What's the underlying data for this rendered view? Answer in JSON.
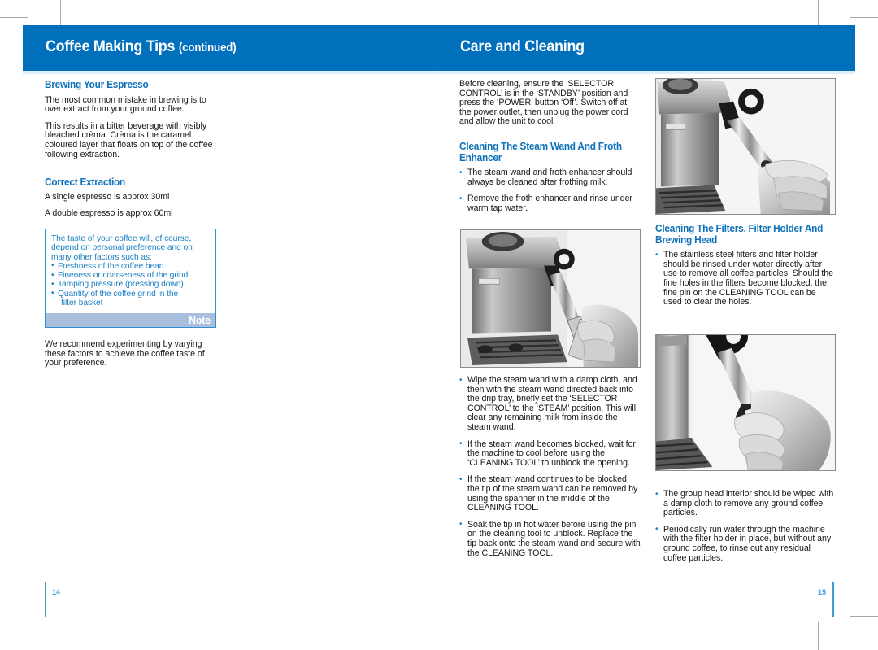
{
  "spread": {
    "left_page": {
      "header": {
        "title": "Coffee Making Tips",
        "suffix": "(continued)"
      },
      "folio": "14",
      "sections": [
        {
          "heading": "Brewing Your Espresso",
          "paragraphs": [
            "The most common mistake in brewing is to over extract from your ground coffee.",
            "This results in a bitter beverage with visibly bleached crèma. Crèma is the caramel coloured layer that floats on top of the coffee following extraction."
          ]
        },
        {
          "heading": "Correct Extraction",
          "paragraphs": [
            "A single espresso is approx 30ml",
            "A double espresso is approx 60ml"
          ]
        }
      ],
      "note_box": {
        "intro": "The taste of your coffee will, of course, depend on personal preference and on many other factors such as:",
        "bullets": [
          "Freshness of the coffee bean",
          "Fineness or coarseness of the grind",
          "Tamping pressure (pressing down)",
          "Quantity of the coffee grind in the"
        ],
        "last_bullet_continuation": "filter basket",
        "label": "Note"
      },
      "closing_paragraph": "We recommend experimenting by varying these factors to achieve the coffee taste of your preference."
    },
    "right_page": {
      "header": {
        "title": "Care and Cleaning",
        "suffix": ""
      },
      "folio": "15",
      "intro_paragraph": "Before cleaning, ensure the ‘SELECTOR CONTROL’ is in the ‘STANDBY’ position and press the ‘POWER’ button ‘Off’. Switch off at the power outlet, then unplug the power cord and allow the unit to cool.",
      "steam_wand_section": {
        "heading": "Cleaning The Steam Wand And Froth Enhancer",
        "bullets_top": [
          "The steam wand and froth enhancer should always be cleaned after frothing milk.",
          "Remove the froth enhancer and rinse under warm tap water."
        ],
        "bullets_bottom": [
          "Wipe the steam wand with a damp cloth, and then with the steam wand directed back into the drip tray, briefly set the ‘SELECTOR CONTROL’ to the ‘STEAM’ position. This will clear any remaining milk from inside the steam wand.",
          "If the steam wand becomes blocked, wait for the machine to cool before using the ‘CLEANING TOOL’ to unblock the opening.",
          "If the steam wand continues to be blocked, the tip of the steam wand can be removed by using the spanner in the middle of the CLEANING TOOL.",
          "Soak the tip in hot water before using the pin on the cleaning tool to unblock. Replace the tip back onto the steam wand and secure with the CLEANING TOOL."
        ]
      },
      "filters_section": {
        "heading": "Cleaning The Filters, Filter Holder And Brewing Head",
        "bullets_top": [
          "The stainless steel filters and filter holder should be rinsed under water directly after use to remove all coffee particles. Should the fine holes in the filters become blocked; the fine pin on the CLEANING TOOL can be used to clear the holes."
        ],
        "bullets_bottom": [
          "The group head interior should be wiped with a damp cloth to remove any ground coffee particles.",
          "Periodically run water through the machine with the filter holder in place, but without any ground coffee, to rinse out any residual coffee particles."
        ]
      }
    },
    "photos": [
      {
        "caption": "espresso machine steam wand with hand holding cleaning tool"
      },
      {
        "caption": "espresso machine steam wand with hand removing froth enhancer"
      },
      {
        "caption": "close-up of hand fitting cleaning tool onto steam wand tip"
      }
    ]
  },
  "colors": {
    "header_blue": "#0070bd",
    "heading_blue": "#0e72bb",
    "note_border": "#2e8fd0",
    "note_bar": "#a9bfdd",
    "folio_blue": "#3f9bd8",
    "crop_mark": "#a8a8a8"
  }
}
